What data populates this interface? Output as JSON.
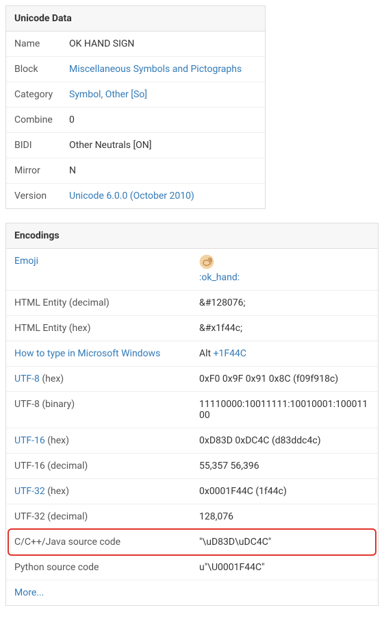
{
  "unicode_data": {
    "title": "Unicode Data",
    "rows": [
      {
        "key": "Name",
        "val": "OK HAND SIGN",
        "link": false
      },
      {
        "key": "Block",
        "val": "Miscellaneous Symbols and Pictographs",
        "link": true
      },
      {
        "key": "Category",
        "val": "Symbol, Other [So]",
        "link": true
      },
      {
        "key": "Combine",
        "val": "0",
        "link": false
      },
      {
        "key": "BIDI",
        "val": "Other Neutrals [ON]",
        "link": false
      },
      {
        "key": "Mirror",
        "val": "N",
        "link": false
      },
      {
        "key": "Version",
        "val": "Unicode 6.0.0 (October 2010)",
        "link": true
      }
    ]
  },
  "encodings": {
    "title": "Encodings",
    "emoji": {
      "key": "Emoji",
      "glyph": "👌",
      "shortcode": ":ok_hand:"
    },
    "rows": [
      {
        "key": "HTML Entity (decimal)",
        "keylink": false,
        "val": "&#128076;",
        "highlight": false
      },
      {
        "key": "HTML Entity (hex)",
        "keylink": false,
        "val": "&#x1f44c;",
        "highlight": false
      },
      {
        "key": "How to type in Microsoft Windows",
        "keylink": true,
        "prefix": "Alt ",
        "val": "+1F44C",
        "highlight": false
      },
      {
        "key": "UTF-8",
        "keylink": true,
        "suffix": " (hex)",
        "val": "0xF0 0x9F 0x91 0x8C (f09f918c)",
        "highlight": false
      },
      {
        "key": "UTF-8 (binary)",
        "keylink": false,
        "val": "11110000:10011111:10010001:10001100",
        "highlight": false
      },
      {
        "key": "UTF-16",
        "keylink": true,
        "suffix": " (hex)",
        "val": "0xD83D 0xDC4C (d83ddc4c)",
        "highlight": false
      },
      {
        "key": "UTF-16 (decimal)",
        "keylink": false,
        "val": "55,357 56,396",
        "highlight": false
      },
      {
        "key": "UTF-32",
        "keylink": true,
        "suffix": " (hex)",
        "val": "0x0001F44C (1f44c)",
        "highlight": false
      },
      {
        "key": "UTF-32 (decimal)",
        "keylink": false,
        "val": "128,076",
        "highlight": false
      },
      {
        "key": "C/C++/Java source code",
        "keylink": false,
        "val": "\"\\uD83D\\uDC4C\"",
        "highlight": true
      },
      {
        "key": "Python source code",
        "keylink": false,
        "val": "u\"\\U0001F44C\"",
        "highlight": false
      }
    ],
    "more_label": "More..."
  }
}
